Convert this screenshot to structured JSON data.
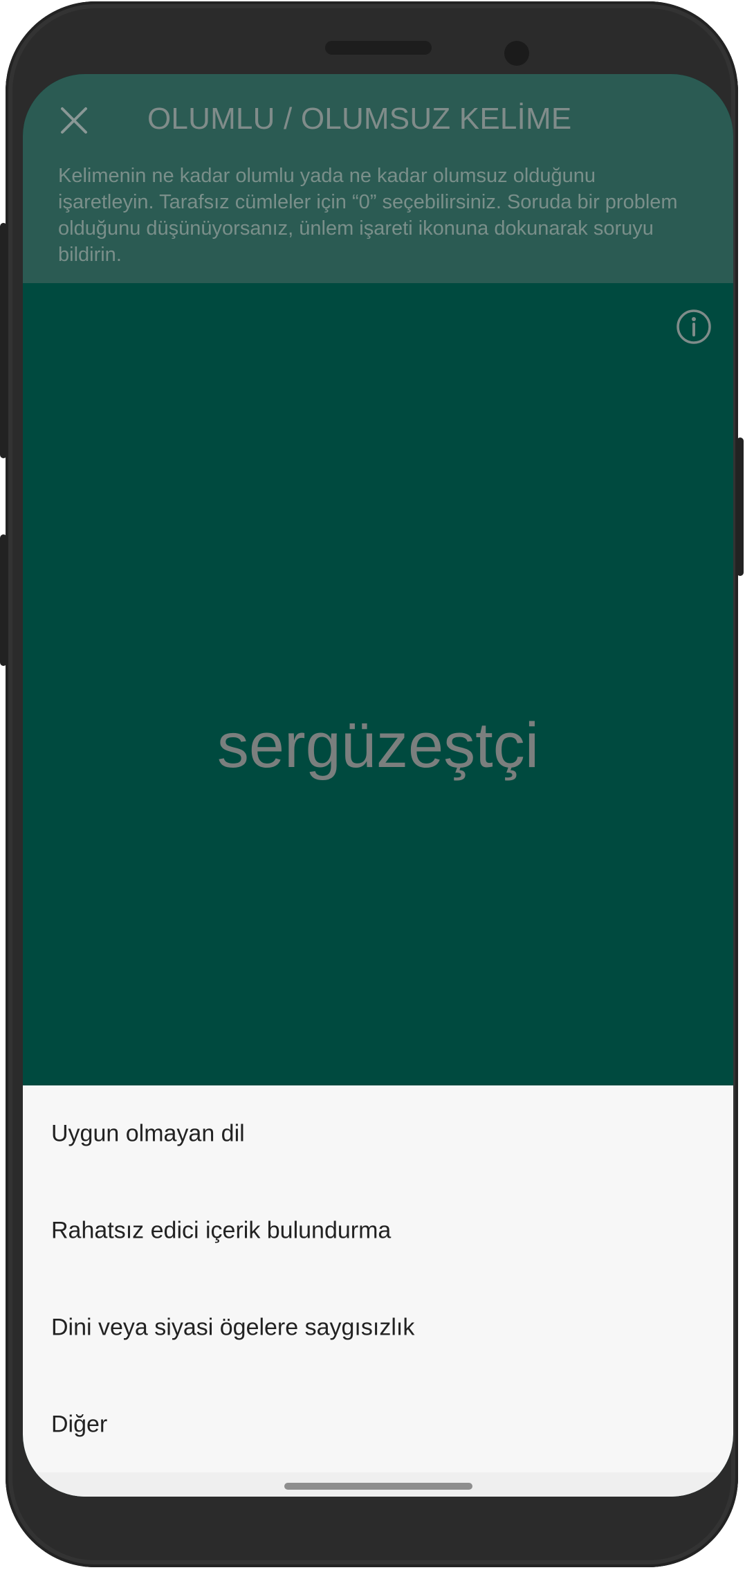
{
  "header": {
    "title": "OLUMLU / OLUMSUZ KELİME",
    "instructions": "Kelimenin ne kadar olumlu yada ne kadar olumsuz olduğunu işaretleyin. Tarafsız cümleler için “0” seçebilirsiniz. Soruda bir problem olduğunu düşünüyorsanız, ünlem işareti ikonuna dokunarak soruyu bildirin.",
    "close_icon": "close-icon"
  },
  "question": {
    "word": "sergüzeştçi",
    "info_icon": "info-icon"
  },
  "report_sheet": {
    "options": [
      "Uygun olmayan dil",
      "Rahatsız edici içerik bulundurma",
      "Dini veya siyasi ögelere saygısızlık",
      "Diğer"
    ]
  },
  "colors": {
    "header_bg": "#2b5b53",
    "main_bg": "#004a3f",
    "sheet_bg": "#f7f7f7",
    "frame": "#2b2b2b"
  }
}
